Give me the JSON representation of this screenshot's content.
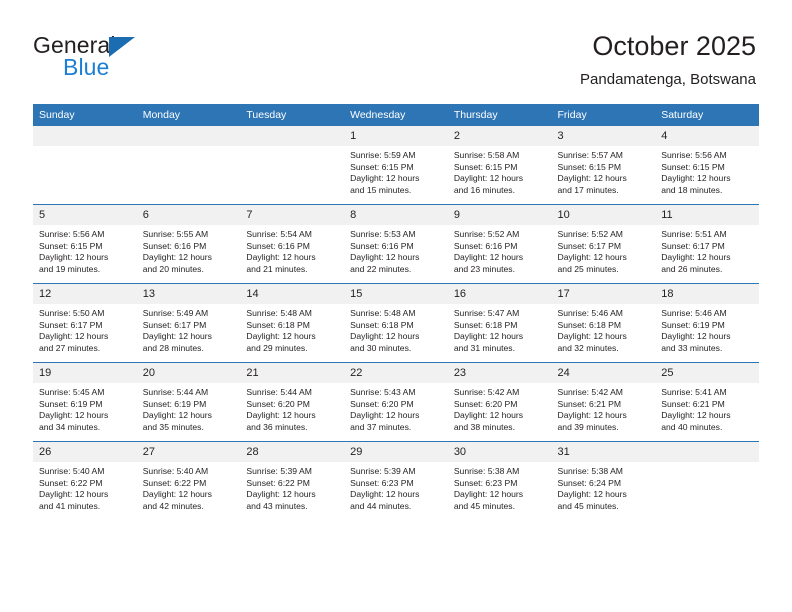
{
  "brand": {
    "name_top": "General",
    "name_bottom": "Blue",
    "logo_icon": "triangle-flag-icon",
    "accent_color": "#1b7fd4",
    "triangle_color": "#1b6cb0"
  },
  "header": {
    "title": "October 2025",
    "subtitle": "Pandamatenga, Botswana"
  },
  "theme": {
    "header_bg": "#2e75b6",
    "header_text": "#ffffff",
    "daynum_bg": "#f1f1f1",
    "cell_bg": "#ffffff",
    "row_border": "#2e75b6",
    "body_text": "#231f20"
  },
  "calendar": {
    "weekday_headers": [
      "Sunday",
      "Monday",
      "Tuesday",
      "Wednesday",
      "Thursday",
      "Friday",
      "Saturday"
    ],
    "labels": {
      "sunrise": "Sunrise:",
      "sunset": "Sunset:",
      "daylight": "Daylight:"
    },
    "weeks": [
      [
        {
          "day": "",
          "blank": true
        },
        {
          "day": "",
          "blank": true
        },
        {
          "day": "",
          "blank": true
        },
        {
          "day": "1",
          "sunrise": "Sunrise: 5:59 AM",
          "sunset": "Sunset: 6:15 PM",
          "daylight_1": "Daylight: 12 hours",
          "daylight_2": "and 15 minutes."
        },
        {
          "day": "2",
          "sunrise": "Sunrise: 5:58 AM",
          "sunset": "Sunset: 6:15 PM",
          "daylight_1": "Daylight: 12 hours",
          "daylight_2": "and 16 minutes."
        },
        {
          "day": "3",
          "sunrise": "Sunrise: 5:57 AM",
          "sunset": "Sunset: 6:15 PM",
          "daylight_1": "Daylight: 12 hours",
          "daylight_2": "and 17 minutes."
        },
        {
          "day": "4",
          "sunrise": "Sunrise: 5:56 AM",
          "sunset": "Sunset: 6:15 PM",
          "daylight_1": "Daylight: 12 hours",
          "daylight_2": "and 18 minutes."
        }
      ],
      [
        {
          "day": "5",
          "sunrise": "Sunrise: 5:56 AM",
          "sunset": "Sunset: 6:15 PM",
          "daylight_1": "Daylight: 12 hours",
          "daylight_2": "and 19 minutes."
        },
        {
          "day": "6",
          "sunrise": "Sunrise: 5:55 AM",
          "sunset": "Sunset: 6:16 PM",
          "daylight_1": "Daylight: 12 hours",
          "daylight_2": "and 20 minutes."
        },
        {
          "day": "7",
          "sunrise": "Sunrise: 5:54 AM",
          "sunset": "Sunset: 6:16 PM",
          "daylight_1": "Daylight: 12 hours",
          "daylight_2": "and 21 minutes."
        },
        {
          "day": "8",
          "sunrise": "Sunrise: 5:53 AM",
          "sunset": "Sunset: 6:16 PM",
          "daylight_1": "Daylight: 12 hours",
          "daylight_2": "and 22 minutes."
        },
        {
          "day": "9",
          "sunrise": "Sunrise: 5:52 AM",
          "sunset": "Sunset: 6:16 PM",
          "daylight_1": "Daylight: 12 hours",
          "daylight_2": "and 23 minutes."
        },
        {
          "day": "10",
          "sunrise": "Sunrise: 5:52 AM",
          "sunset": "Sunset: 6:17 PM",
          "daylight_1": "Daylight: 12 hours",
          "daylight_2": "and 25 minutes."
        },
        {
          "day": "11",
          "sunrise": "Sunrise: 5:51 AM",
          "sunset": "Sunset: 6:17 PM",
          "daylight_1": "Daylight: 12 hours",
          "daylight_2": "and 26 minutes."
        }
      ],
      [
        {
          "day": "12",
          "sunrise": "Sunrise: 5:50 AM",
          "sunset": "Sunset: 6:17 PM",
          "daylight_1": "Daylight: 12 hours",
          "daylight_2": "and 27 minutes."
        },
        {
          "day": "13",
          "sunrise": "Sunrise: 5:49 AM",
          "sunset": "Sunset: 6:17 PM",
          "daylight_1": "Daylight: 12 hours",
          "daylight_2": "and 28 minutes."
        },
        {
          "day": "14",
          "sunrise": "Sunrise: 5:48 AM",
          "sunset": "Sunset: 6:18 PM",
          "daylight_1": "Daylight: 12 hours",
          "daylight_2": "and 29 minutes."
        },
        {
          "day": "15",
          "sunrise": "Sunrise: 5:48 AM",
          "sunset": "Sunset: 6:18 PM",
          "daylight_1": "Daylight: 12 hours",
          "daylight_2": "and 30 minutes."
        },
        {
          "day": "16",
          "sunrise": "Sunrise: 5:47 AM",
          "sunset": "Sunset: 6:18 PM",
          "daylight_1": "Daylight: 12 hours",
          "daylight_2": "and 31 minutes."
        },
        {
          "day": "17",
          "sunrise": "Sunrise: 5:46 AM",
          "sunset": "Sunset: 6:18 PM",
          "daylight_1": "Daylight: 12 hours",
          "daylight_2": "and 32 minutes."
        },
        {
          "day": "18",
          "sunrise": "Sunrise: 5:46 AM",
          "sunset": "Sunset: 6:19 PM",
          "daylight_1": "Daylight: 12 hours",
          "daylight_2": "and 33 minutes."
        }
      ],
      [
        {
          "day": "19",
          "sunrise": "Sunrise: 5:45 AM",
          "sunset": "Sunset: 6:19 PM",
          "daylight_1": "Daylight: 12 hours",
          "daylight_2": "and 34 minutes."
        },
        {
          "day": "20",
          "sunrise": "Sunrise: 5:44 AM",
          "sunset": "Sunset: 6:19 PM",
          "daylight_1": "Daylight: 12 hours",
          "daylight_2": "and 35 minutes."
        },
        {
          "day": "21",
          "sunrise": "Sunrise: 5:44 AM",
          "sunset": "Sunset: 6:20 PM",
          "daylight_1": "Daylight: 12 hours",
          "daylight_2": "and 36 minutes."
        },
        {
          "day": "22",
          "sunrise": "Sunrise: 5:43 AM",
          "sunset": "Sunset: 6:20 PM",
          "daylight_1": "Daylight: 12 hours",
          "daylight_2": "and 37 minutes."
        },
        {
          "day": "23",
          "sunrise": "Sunrise: 5:42 AM",
          "sunset": "Sunset: 6:20 PM",
          "daylight_1": "Daylight: 12 hours",
          "daylight_2": "and 38 minutes."
        },
        {
          "day": "24",
          "sunrise": "Sunrise: 5:42 AM",
          "sunset": "Sunset: 6:21 PM",
          "daylight_1": "Daylight: 12 hours",
          "daylight_2": "and 39 minutes."
        },
        {
          "day": "25",
          "sunrise": "Sunrise: 5:41 AM",
          "sunset": "Sunset: 6:21 PM",
          "daylight_1": "Daylight: 12 hours",
          "daylight_2": "and 40 minutes."
        }
      ],
      [
        {
          "day": "26",
          "sunrise": "Sunrise: 5:40 AM",
          "sunset": "Sunset: 6:22 PM",
          "daylight_1": "Daylight: 12 hours",
          "daylight_2": "and 41 minutes."
        },
        {
          "day": "27",
          "sunrise": "Sunrise: 5:40 AM",
          "sunset": "Sunset: 6:22 PM",
          "daylight_1": "Daylight: 12 hours",
          "daylight_2": "and 42 minutes."
        },
        {
          "day": "28",
          "sunrise": "Sunrise: 5:39 AM",
          "sunset": "Sunset: 6:22 PM",
          "daylight_1": "Daylight: 12 hours",
          "daylight_2": "and 43 minutes."
        },
        {
          "day": "29",
          "sunrise": "Sunrise: 5:39 AM",
          "sunset": "Sunset: 6:23 PM",
          "daylight_1": "Daylight: 12 hours",
          "daylight_2": "and 44 minutes."
        },
        {
          "day": "30",
          "sunrise": "Sunrise: 5:38 AM",
          "sunset": "Sunset: 6:23 PM",
          "daylight_1": "Daylight: 12 hours",
          "daylight_2": "and 45 minutes."
        },
        {
          "day": "31",
          "sunrise": "Sunrise: 5:38 AM",
          "sunset": "Sunset: 6:24 PM",
          "daylight_1": "Daylight: 12 hours",
          "daylight_2": "and 45 minutes."
        },
        {
          "day": "",
          "blank": true
        }
      ]
    ]
  }
}
